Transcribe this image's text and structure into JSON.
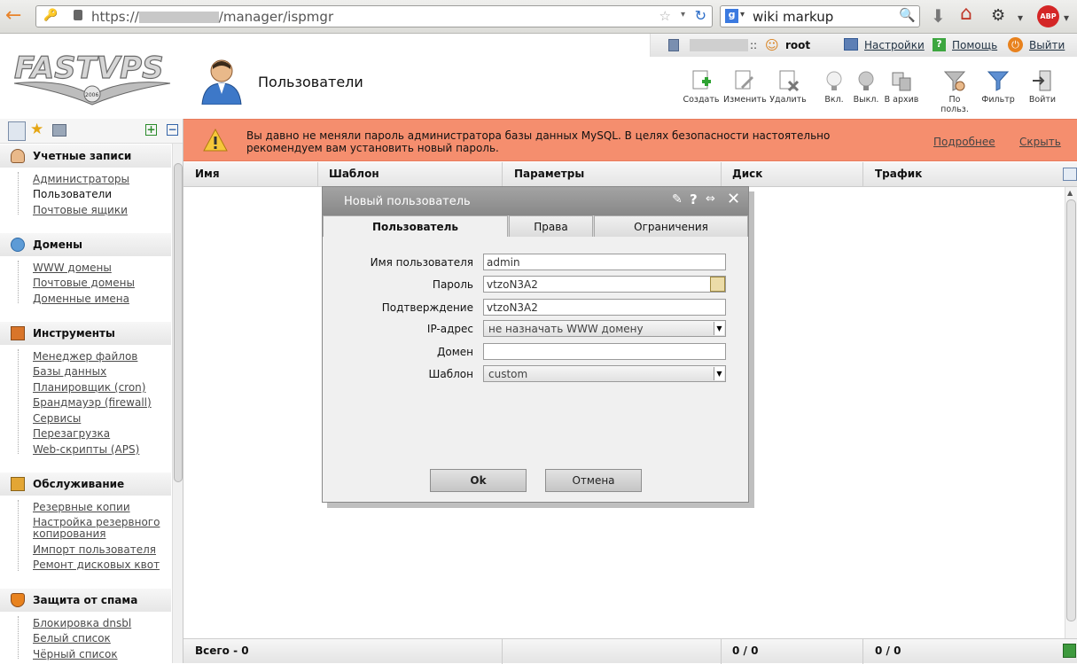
{
  "browser": {
    "url_prefix": "https://",
    "url_suffix": "/manager/ispmgr",
    "search_text": "wiki markup"
  },
  "topbar": {
    "user": "root",
    "settings": "Настройки",
    "help": "Помощь",
    "logout": "Выйти"
  },
  "logo_text": "FASTVPS",
  "logo_year": "2006",
  "page_title": "Пользователи",
  "toolbar": [
    {
      "label": "Создать",
      "icon": "create-icon"
    },
    {
      "label": "Изменить",
      "icon": "edit-icon"
    },
    {
      "label": "Удалить",
      "icon": "delete-icon"
    },
    {
      "label": "Вкл.",
      "icon": "bulb-on-icon"
    },
    {
      "label": "Выкл.",
      "icon": "bulb-off-icon"
    },
    {
      "label": "В архив",
      "icon": "archive-icon"
    },
    {
      "label": "По польз.",
      "icon": "user-filter-icon"
    },
    {
      "label": "Фильтр",
      "icon": "filter-icon"
    },
    {
      "label": "Войти",
      "icon": "login-icon"
    }
  ],
  "sidebar": {
    "sections": [
      {
        "title": "Учетные записи",
        "items": [
          "Администраторы",
          "Пользователи",
          "Почтовые ящики"
        ]
      },
      {
        "title": "Домены",
        "items": [
          "WWW домены",
          "Почтовые домены",
          "Доменные имена"
        ]
      },
      {
        "title": "Инструменты",
        "items": [
          "Менеджер файлов",
          "Базы данных",
          "Планировщик (cron)",
          "Брандмауэр (firewall)",
          "Сервисы",
          "Перезагрузка",
          "Web-скрипты (APS)"
        ]
      },
      {
        "title": "Обслуживание",
        "items": [
          "Резервные копии",
          "Настройка резервного",
          "копирования",
          "Импорт пользователя",
          "Ремонт дисковых квот"
        ]
      },
      {
        "title": "Защита от спама",
        "items": [
          "Блокировка dnsbl",
          "Белый список",
          "Чёрный список"
        ]
      }
    ]
  },
  "warning": {
    "text": "Вы давно не меняли пароль администратора базы данных MySQL. В целях безопасности настоятельно рекомендуем вам установить новый пароль.",
    "more": "Подробнее",
    "hide": "Скрыть"
  },
  "table": {
    "columns": [
      "Имя",
      "Шаблон",
      "Параметры",
      "Диск",
      "Трафик"
    ],
    "footer": {
      "total": "Всего - 0",
      "disk": "0 / 0",
      "traffic": "0 / 0"
    }
  },
  "dialog": {
    "title": "Новый пользователь",
    "tabs": [
      "Пользователь",
      "Права",
      "Ограничения"
    ],
    "fields": {
      "username_label": "Имя пользователя",
      "username_value": "admin",
      "password_label": "Пароль",
      "password_value": "vtzoN3A2",
      "confirm_label": "Подтверждение",
      "confirm_value": "vtzoN3A2",
      "ip_label": "IP-адрес",
      "ip_value": "не назначать WWW домену",
      "domain_label": "Домен",
      "domain_value": "",
      "template_label": "Шаблон",
      "template_value": "custom"
    },
    "ok": "Ok",
    "cancel": "Отмена"
  },
  "colors": {
    "warning_bg": "#f58e6e",
    "dialog_title": "#999999"
  }
}
